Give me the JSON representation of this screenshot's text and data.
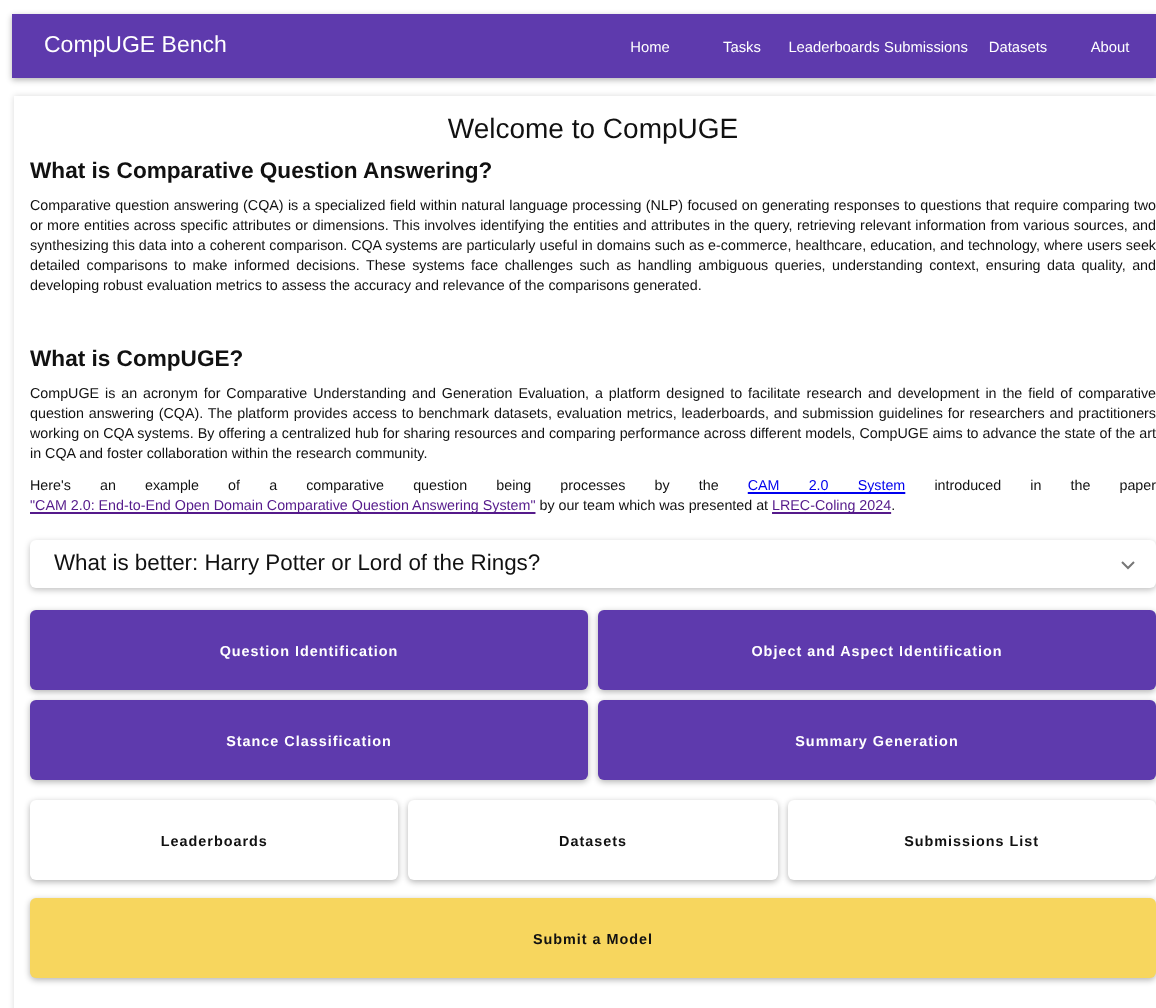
{
  "header": {
    "brand": "CompUGE Bench",
    "nav": [
      {
        "label": "Home"
      },
      {
        "label": "Tasks"
      },
      {
        "label": "Leaderboards"
      },
      {
        "label": "Submissions"
      },
      {
        "label": "Datasets"
      },
      {
        "label": "About"
      }
    ]
  },
  "title": "Welcome to CompUGE",
  "sections": [
    {
      "heading": "What is Comparative Question Answering?",
      "paragraphs": [
        [
          {
            "kind": "text",
            "text": "Comparative question answering (CQA) is a specialized field within natural language processing (NLP) focused on generating responses to questions that require comparing two or more entities across specific attributes or dimensions. This involves identifying the entities and attributes in the query, retrieving relevant information from various sources, and synthesizing this data into a coherent comparison. CQA systems are particularly useful in domains such as e-commerce, healthcare, education, and technology, where users seek detailed comparisons to make informed decisions. These systems face challenges such as handling ambiguous queries, understanding context, ensuring data quality, and developing robust evaluation metrics to assess the accuracy and relevance of the comparisons generated."
          }
        ]
      ]
    },
    {
      "heading": "What is CompUGE?",
      "paragraphs": [
        [
          {
            "kind": "text",
            "text": "CompUGE is an acronym for Comparative Understanding and Generation Evaluation, a platform designed to facilitate research and development in the field of comparative question answering (CQA). The platform provides access to benchmark datasets, evaluation metrics, leaderboards, and submission guidelines for researchers and practitioners working on CQA systems. By offering a centralized hub for sharing resources and comparing performance across different models, CompUGE aims to advance the state of the art in CQA and foster collaboration within the research community."
          }
        ],
        [
          {
            "kind": "text",
            "text": "Here's an example of a comparative question being processes by the "
          },
          {
            "kind": "link",
            "text": "CAM 2.0 System",
            "visited": false
          },
          {
            "kind": "text",
            "text": " introduced in the paper "
          },
          {
            "kind": "link",
            "text": "\"CAM 2.0: End-to-End Open Domain Comparative Question Answering System\"",
            "visited": true
          },
          {
            "kind": "text",
            "text": " by our team which was presented at "
          },
          {
            "kind": "link",
            "text": "LREC-Coling 2024",
            "visited": true
          },
          {
            "kind": "text",
            "text": "."
          }
        ]
      ]
    }
  ],
  "accordion": {
    "title": "What is better: Harry Potter or Lord of the Rings?",
    "expanded": false
  },
  "task_buttons": [
    {
      "label": "Question Identification"
    },
    {
      "label": "Object and Aspect Identification"
    },
    {
      "label": "Stance Classification"
    },
    {
      "label": "Summary Generation"
    }
  ],
  "page_buttons": [
    {
      "label": "Leaderboards"
    },
    {
      "label": "Datasets"
    },
    {
      "label": "Submissions List"
    }
  ],
  "submit_button": {
    "label": "Submit a Model"
  }
}
